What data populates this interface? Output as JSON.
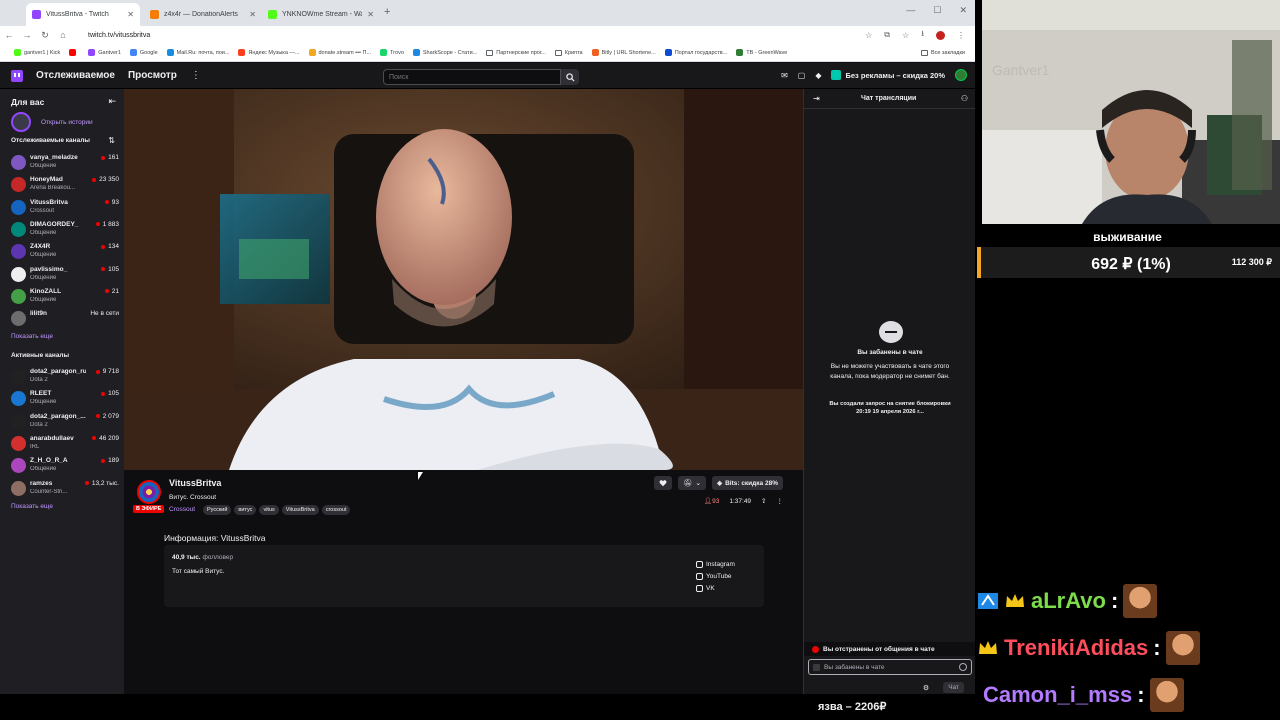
{
  "browser": {
    "tabs": [
      {
        "title": "VitussBritva - Twitch",
        "color": "#9147ff"
      },
      {
        "title": "z4x4r — DonationAlerts",
        "color": "#f57d07"
      },
      {
        "title": "YNKNOWme Stream - Watch Li...",
        "color": "#53fc18"
      }
    ],
    "url": "twitch.tv/vitussbritva",
    "bookmarks": [
      {
        "label": "gantver1 | Kick",
        "color": "#53fc18"
      },
      {
        "label": "",
        "color": "#ff0000"
      },
      {
        "label": "Gantver1",
        "color": "#9147ff"
      },
      {
        "label": "Google",
        "color": "#4285f4"
      },
      {
        "label": "Mail.Ru: почта, пои...",
        "color": "#168de2"
      },
      {
        "label": "Яндекс Музыка —...",
        "color": "#fc3f1d"
      },
      {
        "label": "donate.stream ••• П...",
        "color": "#f5a623"
      },
      {
        "label": "Trovo",
        "color": "#19d66b"
      },
      {
        "label": "SharkScope - Стати...",
        "color": "#1e88e5"
      },
      {
        "label": "Партнерские прог...",
        "color": "folder"
      },
      {
        "label": "Крипта",
        "color": "folder"
      },
      {
        "label": "Bitly | URL Shortene...",
        "color": "#ee6123"
      },
      {
        "label": "Портал государств...",
        "color": "#0d4cd3"
      },
      {
        "label": "TB - GreenWave",
        "color": "#2e7d32"
      }
    ],
    "all_bookmarks": "Все закладки"
  },
  "twitch": {
    "nav": {
      "following": "Отслеживаемое",
      "browse": "Просмотр",
      "more": "⋮",
      "search_placeholder": "Поиск",
      "promo": "Без рекламы – скидка 20%"
    },
    "sidebar": {
      "for_you": "Для вас",
      "stories": "Открыть истории",
      "followed_title": "Отслеживаемые каналы",
      "followed": [
        {
          "name": "vanya_meladze",
          "game": "Общение",
          "viewers": "161",
          "color": "#7e57c2"
        },
        {
          "name": "HoneyMad",
          "game": "Arena Breakou...",
          "viewers": "23 350",
          "color": "#c62828"
        },
        {
          "name": "VitussBritva",
          "game": "Crossout",
          "viewers": "93",
          "color": "#1565c0"
        },
        {
          "name": "DIMAGORDEY_",
          "game": "Общение",
          "viewers": "1 883",
          "color": "#00897b"
        },
        {
          "name": "Z4X4R",
          "game": "Общение",
          "viewers": "134",
          "color": "#5e35b1"
        },
        {
          "name": "pavlissimo_",
          "game": "Общение",
          "viewers": "105",
          "color": "#eeeeee"
        },
        {
          "name": "KinoZALL",
          "game": "Общение",
          "viewers": "21",
          "color": "#43a047"
        },
        {
          "name": "lilit9n",
          "game": "",
          "viewers": "Не в сети",
          "color": "#6d6d6d"
        }
      ],
      "show_more": "Показать еще",
      "active_title": "Активные каналы",
      "active": [
        {
          "name": "dota2_paragon_ru",
          "game": "Dota 2",
          "viewers": "9 718",
          "color": "#212121"
        },
        {
          "name": "RLEET",
          "game": "Общение",
          "viewers": "105",
          "color": "#1976d2"
        },
        {
          "name": "dota2_paragon_...",
          "game": "Dota 2",
          "viewers": "2 079",
          "color": "#212121"
        },
        {
          "name": "anarabdullaev",
          "game": "IRL",
          "viewers": "46 209",
          "color": "#d32f2f"
        },
        {
          "name": "Z_H_O_R_A",
          "game": "Общение",
          "viewers": "189",
          "color": "#ab47bc"
        },
        {
          "name": "ramzes",
          "game": "Counter-Stri...",
          "viewers": "13,2 тыс.",
          "color": "#8d6e63"
        }
      ],
      "show_more_2": "Показать еще"
    },
    "channel": {
      "live_badge": "В ЭФИРЕ",
      "name": "VitussBritva",
      "title": "Витус. Crossout",
      "game": "Crossout",
      "tags": [
        "Русский",
        "витус",
        "vitus",
        "VitussBritva",
        "crossout"
      ],
      "bits": "Bits: скидка 28%",
      "viewers": "93",
      "uptime": "1:37:49",
      "about_title": "Информация: VitussBritva",
      "followers_count": "40,9 тыс.",
      "followers_label": "фолловер",
      "bio": "Тот самый Витус.",
      "socials": [
        "Instagram",
        "YouTube",
        "VK"
      ]
    },
    "chat": {
      "title": "Чат трансляции",
      "banned_title": "Вы забанены в чате",
      "banned_desc": "Вы не можете участвовать в чате этого канала, пока модератор не снимет бан.",
      "unban_request": "Вы создали запрос на снятие блокировки 20:19 19 апреля 2026 г...",
      "timeout": "Вы отстранены от общения в чате",
      "input_placeholder": "Вы забанены в чате",
      "chat_button": "Чат"
    }
  },
  "overlay": {
    "goal_label": "выживание",
    "goal_amount": "692 ₽ (1%)",
    "goal_target": "112 300 ₽",
    "chat": [
      {
        "user": "aLrAvo",
        "color": "#7cdc4a"
      },
      {
        "user": "TrenikiAdidas",
        "color": "#ff4d5e"
      },
      {
        "user": "Camon_i_mss",
        "color": "#b37bff"
      }
    ],
    "bottom_text": "язва – 2206₽"
  }
}
